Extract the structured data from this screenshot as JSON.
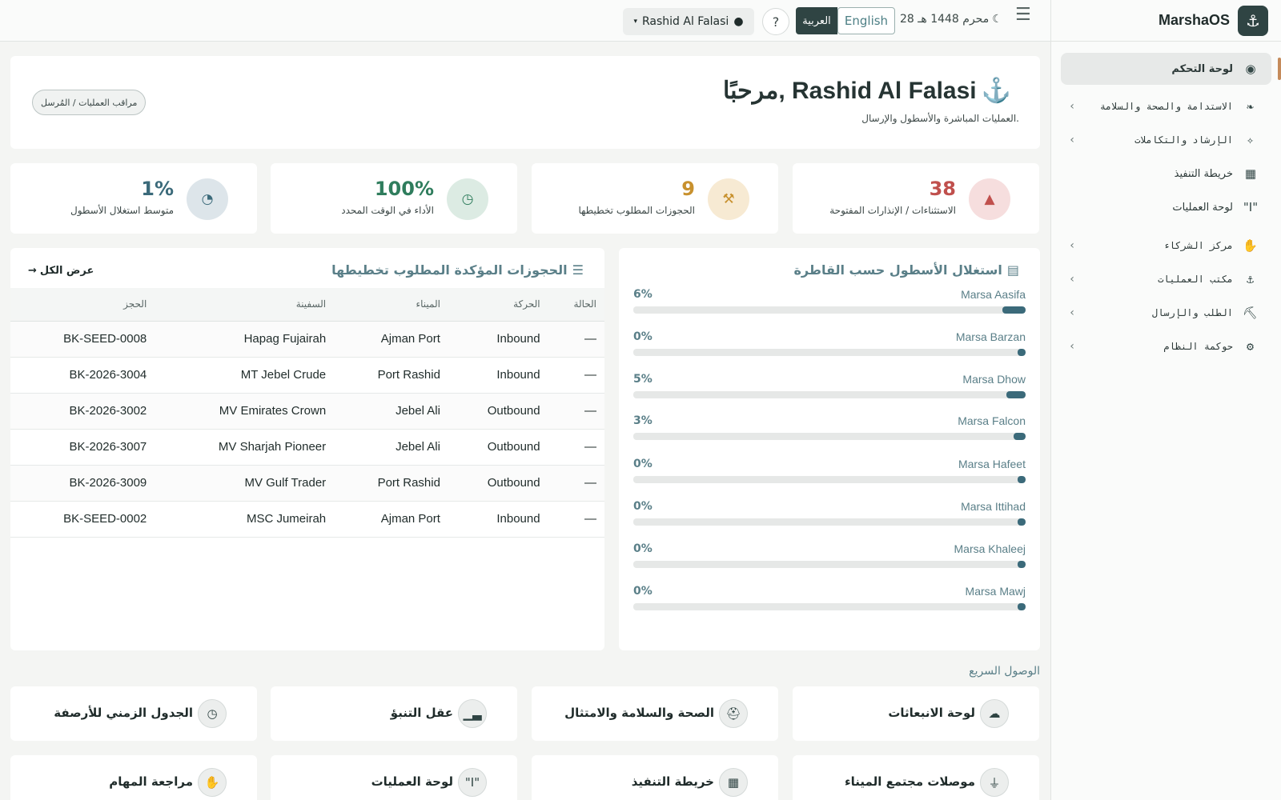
{
  "brand": {
    "name": "MarshaOS",
    "logo": "anchor-icon"
  },
  "nav": [
    {
      "label": "لوحة التحكم",
      "icon": "dashboard-icon",
      "active": true,
      "has_children": false
    },
    {
      "label": "الاستدامة والصحة والسلامة",
      "icon": "leaf-icon",
      "has_children": true
    },
    {
      "label": "الإرشاد والتكاملات",
      "icon": "wand-icon",
      "has_children": true
    },
    {
      "label": "خريطة التنفيذ",
      "icon": "map-icon",
      "has_children": false
    },
    {
      "label": "لوحة العمليات",
      "icon": "quote-icon",
      "has_children": false
    },
    {
      "label": "مركز الشركاء",
      "icon": "handshake-icon",
      "has_children": true
    },
    {
      "label": "مكتب العمليات",
      "icon": "anchor-icon",
      "has_children": true
    },
    {
      "label": "الطلب والإرسال",
      "icon": "dispatch-icon",
      "has_children": true
    },
    {
      "label": "حوكمة النظام",
      "icon": "gear-icon",
      "has_children": true
    }
  ],
  "topbar": {
    "hijri_date": "28 محرم 1448 هـ",
    "lang_en": "English",
    "lang_ar": "العربية",
    "help": "?",
    "user_name": "Rashid Al Falasi"
  },
  "welcome": {
    "title": "مرحبًا, Rashid Al Falasi",
    "subtitle": "العمليات المباشرة والأسطول والإرسال.",
    "role": "مراقب العمليات / المُرسل"
  },
  "stats": [
    {
      "value": "38",
      "label": "الاستثناءات / الإنذارات المفتوحة",
      "icon": "warning-icon",
      "color": "#c0504d",
      "bg": "#f6dede"
    },
    {
      "value": "9",
      "label": "الحجوزات المطلوب تخطيطها",
      "icon": "compass-icon",
      "color": "#c8912e",
      "bg": "#f7ead3"
    },
    {
      "value": "100%",
      "label": "الأداء في الوقت المحدد",
      "icon": "clock-icon",
      "color": "#2f7d5d",
      "bg": "#dcebe3"
    },
    {
      "value": "1%",
      "label": "متوسط استغلال الأسطول",
      "icon": "gauge-icon",
      "color": "#3b6a7a",
      "bg": "#dde5ea"
    }
  ],
  "fleet": {
    "title": "استغلال الأسطول حسب القاطرة",
    "rows": [
      {
        "name": "Marsa Aasifa",
        "pct_label": "6%",
        "pct": 6
      },
      {
        "name": "Marsa Barzan",
        "pct_label": "0%",
        "pct": 0
      },
      {
        "name": "Marsa Dhow",
        "pct_label": "5%",
        "pct": 5
      },
      {
        "name": "Marsa Falcon",
        "pct_label": "3%",
        "pct": 3
      },
      {
        "name": "Marsa Hafeet",
        "pct_label": "0%",
        "pct": 0
      },
      {
        "name": "Marsa Ittihad",
        "pct_label": "0%",
        "pct": 0
      },
      {
        "name": "Marsa Khaleej",
        "pct_label": "0%",
        "pct": 0
      },
      {
        "name": "Marsa Mawj",
        "pct_label": "0%",
        "pct": 0
      }
    ]
  },
  "bookings": {
    "title": "الحجوزات المؤكدة المطلوب تخطيطها",
    "view_all": "عرض الكل",
    "columns": [
      "الحجز",
      "السفينة",
      "الميناء",
      "الحركة",
      "الحالة"
    ],
    "rows": [
      [
        "BK-SEED-0008",
        "Hapag Fujairah",
        "Ajman Port",
        "Inbound",
        "—"
      ],
      [
        "BK-2026-3004",
        "MT Jebel Crude",
        "Port Rashid",
        "Inbound",
        "—"
      ],
      [
        "BK-2026-3002",
        "MV Emirates Crown",
        "Jebel Ali",
        "Outbound",
        "—"
      ],
      [
        "BK-2026-3007",
        "MV Sharjah Pioneer",
        "Jebel Ali",
        "Outbound",
        "—"
      ],
      [
        "BK-2026-3009",
        "MV Gulf Trader",
        "Port Rashid",
        "Outbound",
        "—"
      ],
      [
        "BK-SEED-0002",
        "MSC Jumeirah",
        "Ajman Port",
        "Inbound",
        "—"
      ]
    ]
  },
  "quick_access": {
    "title": "الوصول السريع",
    "items": [
      {
        "label": "لوحة الانبعاثات",
        "icon": "cloud-icon"
      },
      {
        "label": "الصحة والسلامة والامتثال",
        "icon": "hardhat-icon"
      },
      {
        "label": "عقل التنبؤ",
        "icon": "chart-icon"
      },
      {
        "label": "الجدول الزمني للأرصفة",
        "icon": "clock-icon"
      },
      {
        "label": "موصلات مجتمع الميناء",
        "icon": "plug-icon"
      },
      {
        "label": "خريطة التنفيذ",
        "icon": "map-icon"
      },
      {
        "label": "لوحة العمليات",
        "icon": "quote-icon"
      },
      {
        "label": "مراجعة المهام",
        "icon": "handshake-icon"
      }
    ]
  }
}
